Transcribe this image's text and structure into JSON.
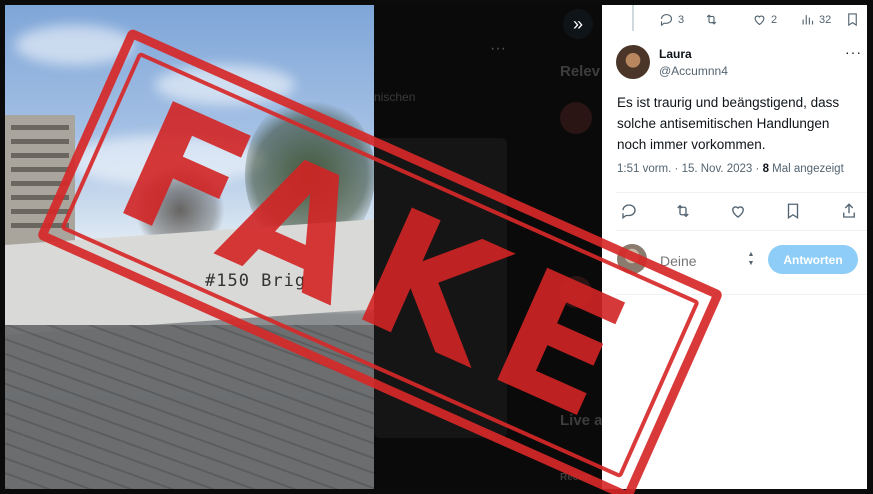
{
  "dark_background": {
    "more": "···",
    "relevant_heading": "Relev",
    "text_fragment": "nischen",
    "live_heading": "Live a",
    "recommendation_fragment": "Recon"
  },
  "photo": {
    "graffiti_text": "#150 Brig"
  },
  "stamp": {
    "text": "FAKE",
    "color": "#d62828"
  },
  "expand_icon": "»",
  "metrics": {
    "replies": "3",
    "likes": "2",
    "views": "32"
  },
  "tweet": {
    "author_name": "Laura",
    "author_handle": "@Accumnn4",
    "more": "···",
    "text": "Es ist traurig und beängstigend, dass solche antisemitischen Handlungen noch immer vorkommen.",
    "time": "1:51 vorm.",
    "separator": " · ",
    "date": "15. Nov. 2023",
    "dot": " · ",
    "views_count": "8",
    "views_label": " Mal angezeigt"
  },
  "reply": {
    "placeholder": "Deine",
    "button_label": "Antworten"
  },
  "colors": {
    "accent": "#8ecdf8",
    "text_secondary": "#536471",
    "text_primary": "#0f1419"
  }
}
